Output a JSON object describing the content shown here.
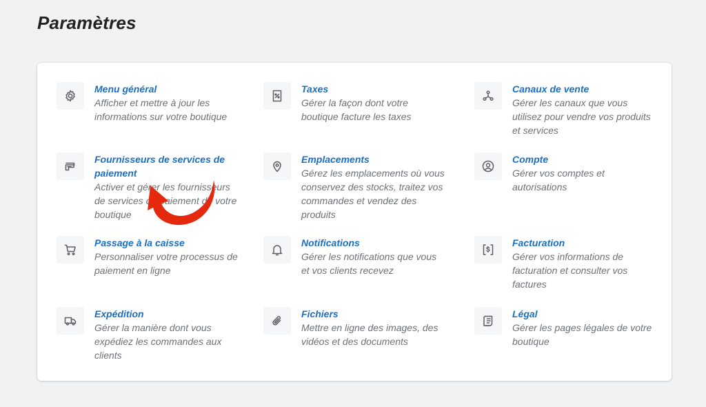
{
  "page": {
    "title": "Paramètres"
  },
  "settings": [
    {
      "id": "general",
      "icon": "gear-icon",
      "title": "Menu général",
      "description": "Afficher et mettre à jour les informations sur votre boutique"
    },
    {
      "id": "taxes",
      "icon": "tax-receipt-icon",
      "title": "Taxes",
      "description": "Gérer la façon dont votre boutique facture les taxes"
    },
    {
      "id": "sales-channels",
      "icon": "channels-icon",
      "title": "Canaux de vente",
      "description": "Gérer les canaux que vous utilisez pour vendre vos produits et services"
    },
    {
      "id": "payment-providers",
      "icon": "credit-card-icon",
      "title": "Fournisseurs de services de paiement",
      "description": "Activer et gérer les fournisseurs de services de paiement de votre boutique"
    },
    {
      "id": "locations",
      "icon": "location-pin-icon",
      "title": "Emplacements",
      "description": "Gérez les emplacements où vous conservez des stocks, traitez vos commandes et vendez des produits"
    },
    {
      "id": "account",
      "icon": "user-circle-icon",
      "title": "Compte",
      "description": "Gérer vos comptes et autorisations"
    },
    {
      "id": "checkout",
      "icon": "cart-icon",
      "title": "Passage à la caisse",
      "description": "Personnaliser votre processus de paiement en ligne"
    },
    {
      "id": "notifications",
      "icon": "bell-icon",
      "title": "Notifications",
      "description": "Gérer les notifications que vous et vos clients recevez"
    },
    {
      "id": "billing",
      "icon": "billing-icon",
      "title": "Facturation",
      "description": "Gérer vos informations de facturation et consulter vos factures"
    },
    {
      "id": "shipping",
      "icon": "truck-icon",
      "title": "Expédition",
      "description": "Gérer la manière dont vous expédiez les commandes aux clients"
    },
    {
      "id": "files",
      "icon": "paperclip-icon",
      "title": "Fichiers",
      "description": "Mettre en ligne des images, des vidéos et des documents"
    },
    {
      "id": "legal",
      "icon": "legal-document-icon",
      "title": "Légal",
      "description": "Gérer les pages légales de votre boutique"
    }
  ],
  "colors": {
    "link": "#1a6fc4",
    "arrow": "#e4290f",
    "background": "#f1f2f4"
  }
}
